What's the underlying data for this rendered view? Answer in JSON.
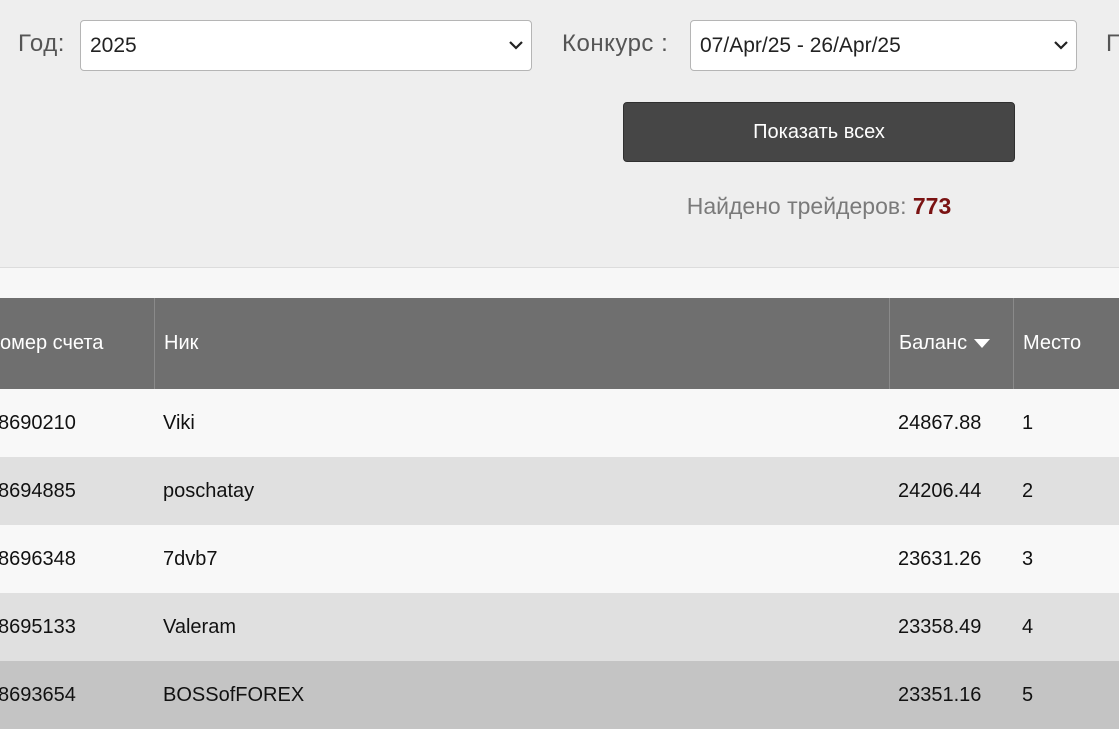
{
  "filters": {
    "year_label": "Год:",
    "year_value": "2025",
    "contest_label": "Конкурс :",
    "contest_value": "07/Apr/25 - 26/Apr/25",
    "next_label_partial": "П"
  },
  "actions": {
    "show_all_label": "Показать всех"
  },
  "summary": {
    "found_label": "Найдено трейдеров:",
    "found_count": "773"
  },
  "table": {
    "headers": {
      "account": "омер счета",
      "nick": "Ник",
      "balance": "Баланс",
      "place": "Место"
    },
    "sort_icon": "caret-down-icon",
    "rows": [
      {
        "account": "8690210",
        "nick": "Viki",
        "balance": "24867.88",
        "place": "1"
      },
      {
        "account": "8694885",
        "nick": "poschatay",
        "balance": "24206.44",
        "place": "2"
      },
      {
        "account": "8696348",
        "nick": "7dvb7",
        "balance": "23631.26",
        "place": "3"
      },
      {
        "account": "8695133",
        "nick": "Valeram",
        "balance": "23358.49",
        "place": "4"
      },
      {
        "account": "8693654",
        "nick": "BOSSofFOREX",
        "balance": "23351.16",
        "place": "5"
      }
    ]
  },
  "colors": {
    "header_bg": "#6f6f6f",
    "row_light": "#f8f8f8",
    "row_mid": "#e0e0e0",
    "row_highlight": "#c4c4c4",
    "count_color": "#7a1212",
    "button_bg": "#464646"
  }
}
